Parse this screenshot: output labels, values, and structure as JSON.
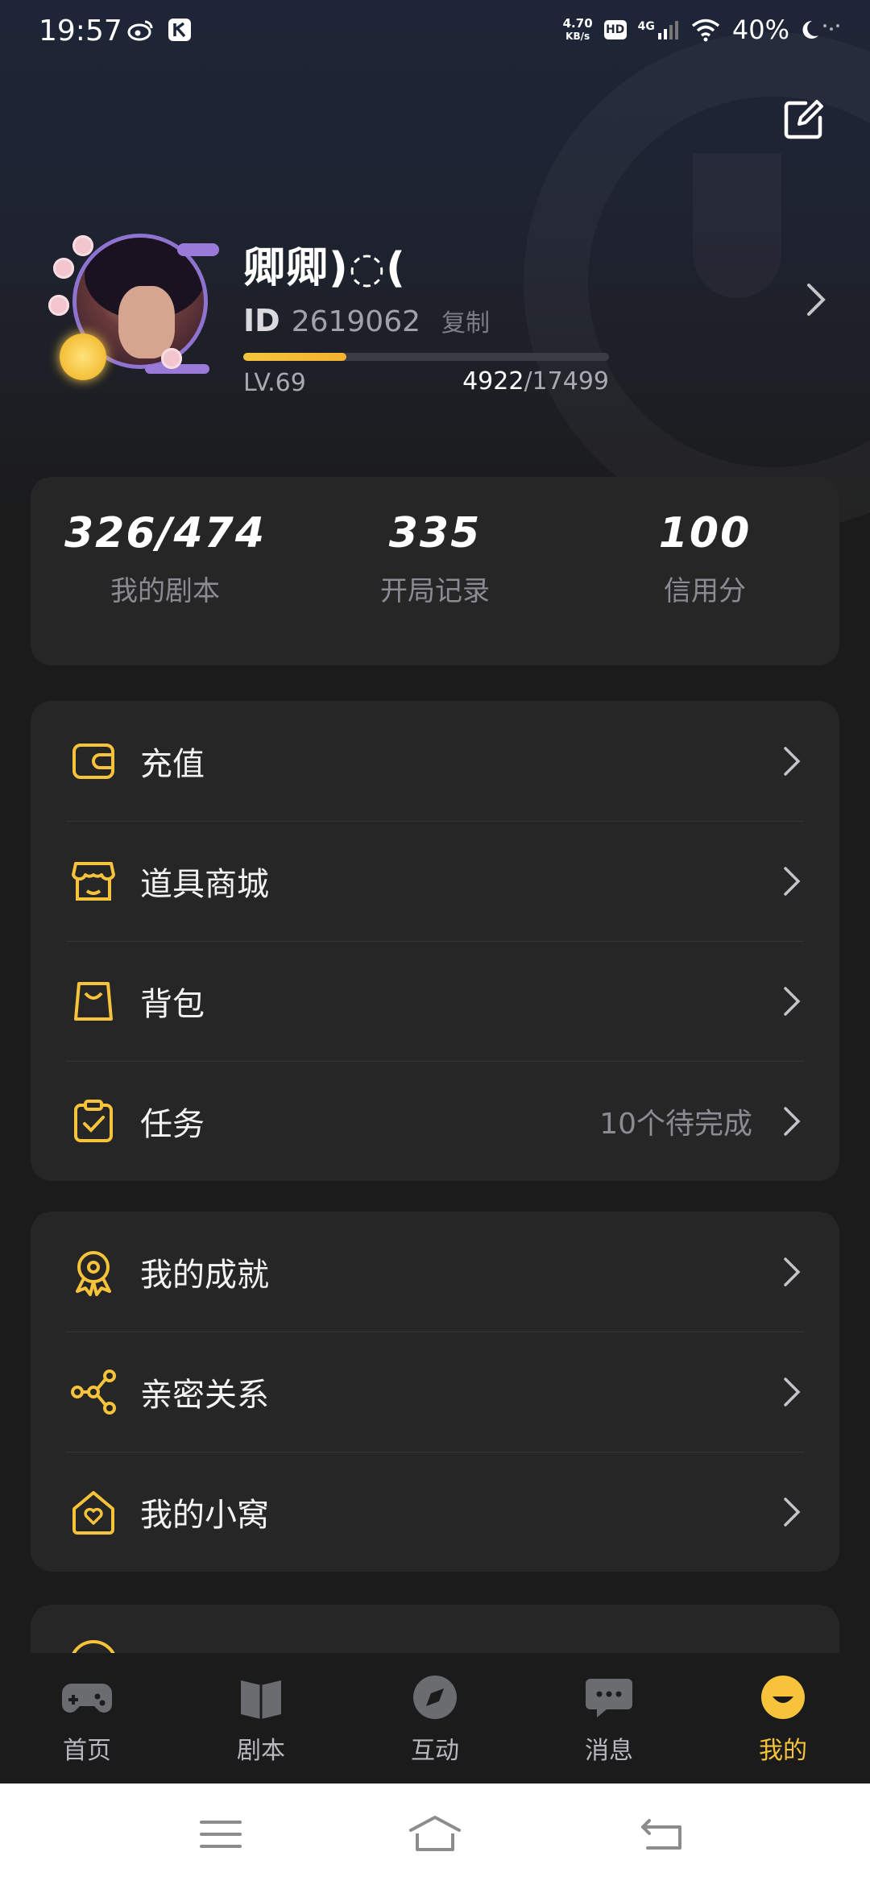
{
  "status_bar": {
    "time": "19:57",
    "net_speed_value": "4.70",
    "net_speed_unit": "KB/s",
    "hd": "HD",
    "signal": "4G",
    "battery": "40%"
  },
  "profile": {
    "username": "卿卿)◌(",
    "id_label": "ID",
    "id_value": "2619062",
    "copy_label": "复制",
    "level": "LV.69",
    "exp_current": "4922",
    "exp_total": "/17499",
    "exp_progress": 0.281
  },
  "stats": [
    {
      "value": "326/474",
      "label": "我的剧本"
    },
    {
      "value": "335",
      "label": "开局记录"
    },
    {
      "value": "100",
      "label": "信用分"
    }
  ],
  "menu_group_1": [
    {
      "label": "充值",
      "hint": "",
      "icon": "wallet-icon"
    },
    {
      "label": "道具商城",
      "hint": "",
      "icon": "store-icon"
    },
    {
      "label": "背包",
      "hint": "",
      "icon": "bag-icon"
    },
    {
      "label": "任务",
      "hint": "10个待完成",
      "icon": "task-icon"
    }
  ],
  "menu_group_2": [
    {
      "label": "我的成就",
      "icon": "achievement-icon"
    },
    {
      "label": "亲密关系",
      "icon": "relationship-icon"
    },
    {
      "label": "我的小窝",
      "icon": "home-heart-icon"
    }
  ],
  "bottom_nav": [
    {
      "label": "首页",
      "icon": "gamepad-icon"
    },
    {
      "label": "剧本",
      "icon": "book-icon"
    },
    {
      "label": "互动",
      "icon": "compass-icon"
    },
    {
      "label": "消息",
      "icon": "chat-icon"
    },
    {
      "label": "我的",
      "icon": "smile-icon",
      "active": true
    }
  ],
  "colors": {
    "accent": "#f6c33a",
    "card": "#262627",
    "background": "#1b1b1c"
  }
}
